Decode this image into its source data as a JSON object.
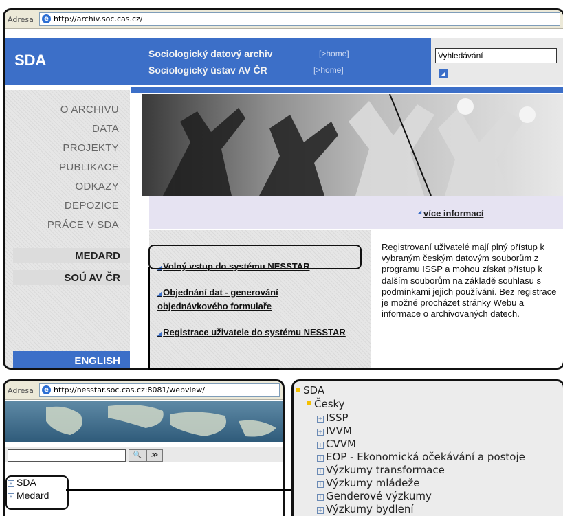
{
  "main_window": {
    "address_label": "Adresa",
    "url": "http://archiv.soc.cas.cz/",
    "header": {
      "logo": "SDA",
      "title1": "Sociologický datový archiv",
      "home1": "[>home]",
      "title2": "Sociologický ústav AV ČR",
      "home2": "[>home]",
      "search_value": "Vyhledávání"
    },
    "nav": [
      "O ARCHIVU",
      "DATA",
      "PROJEKTY",
      "PUBLIKACE",
      "ODKAZY",
      "DEPOZICE",
      "PRÁCE V SDA"
    ],
    "nav_boxes": [
      "MEDARD",
      "SOÚ AV ČR"
    ],
    "english": "ENGLISH",
    "more_info": "více informací",
    "links": [
      "Volný vstup do systému NESSTAR",
      "Objednání dat - generování objednávkového formulaře",
      "Registrace uživatele do systému NESSTAR"
    ],
    "description": "Registrovaní uživatelé mají plný přístup k vybraným českým datovým souborům z programu ISSP a mohou získat přístup k dalším souborům na základě souhlasu s podmínkami jejich používání. Bez registrace je možné procházet stránky Webu a informace o archivovaných datech."
  },
  "nesstar_window": {
    "address_label": "Adresa",
    "url": "http://nesstar.soc.cas.cz:8081/webview/",
    "search_btn": "🔍",
    "next_btn": "≫",
    "tree": [
      "SDA",
      "Medard"
    ]
  },
  "tree_panel": {
    "root": "SDA",
    "child": "Česky",
    "items": [
      "ISSP",
      "IVVM",
      "CVVM",
      "EOP - Ekonomická očekávání a postoje",
      "Výzkumy transformace",
      "Výzkumy mládeže",
      "Genderové výzkumy",
      "Výzkumy bydlení"
    ]
  },
  "colors": {
    "accent": "#3c6fc8",
    "nav_text": "#666666",
    "lavender": "#e6e3f2"
  }
}
